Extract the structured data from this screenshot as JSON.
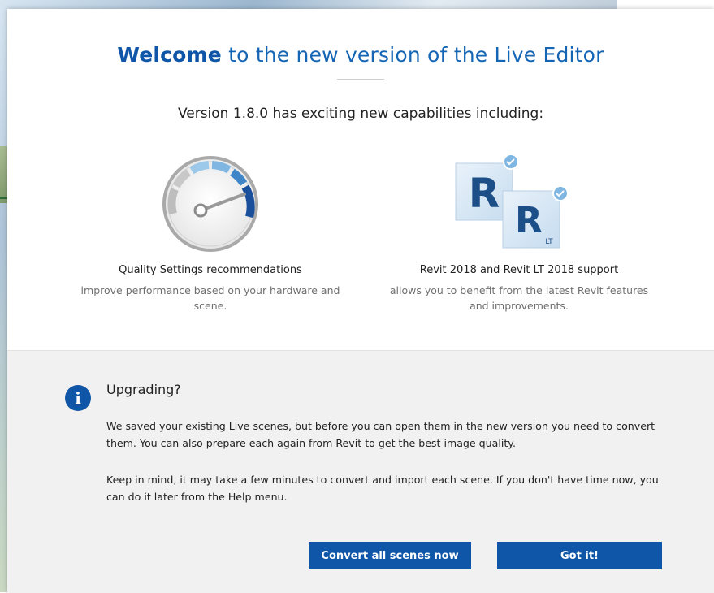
{
  "dialog": {
    "headline_strong": "Welcome",
    "headline_rest": " to the new version of the Live Editor",
    "subhead": "Version 1.8.0 has exciting new capabilities including:"
  },
  "features": [
    {
      "icon": "speedometer-icon",
      "title": "Quality Settings recommendations",
      "description": "improve performance based on your hardware and scene."
    },
    {
      "icon": "revit-logos-icon",
      "title": "Revit 2018 and Revit LT 2018 support",
      "description": "allows you to benefit from the latest Revit features and improvements.",
      "logo_letter": "R",
      "logo_badge": "LT"
    }
  ],
  "upgrade": {
    "icon": "info-icon",
    "icon_glyph": "i",
    "title": "Upgrading?",
    "paragraph1": "We saved your existing Live scenes, but before you can open them in the new version you need to convert them. You can also prepare each again from Revit to get the best image quality.",
    "paragraph2": "Keep in mind, it may take a few minutes to convert and import each scene. If you don't have time now, you can do it later from the Help menu."
  },
  "buttons": {
    "convert_label": "Convert all scenes now",
    "got_it_label": "Got it!"
  },
  "colors": {
    "accent": "#0f56a8",
    "lower_panel": "#f1f1f1",
    "muted_text": "#6f6f6f"
  }
}
